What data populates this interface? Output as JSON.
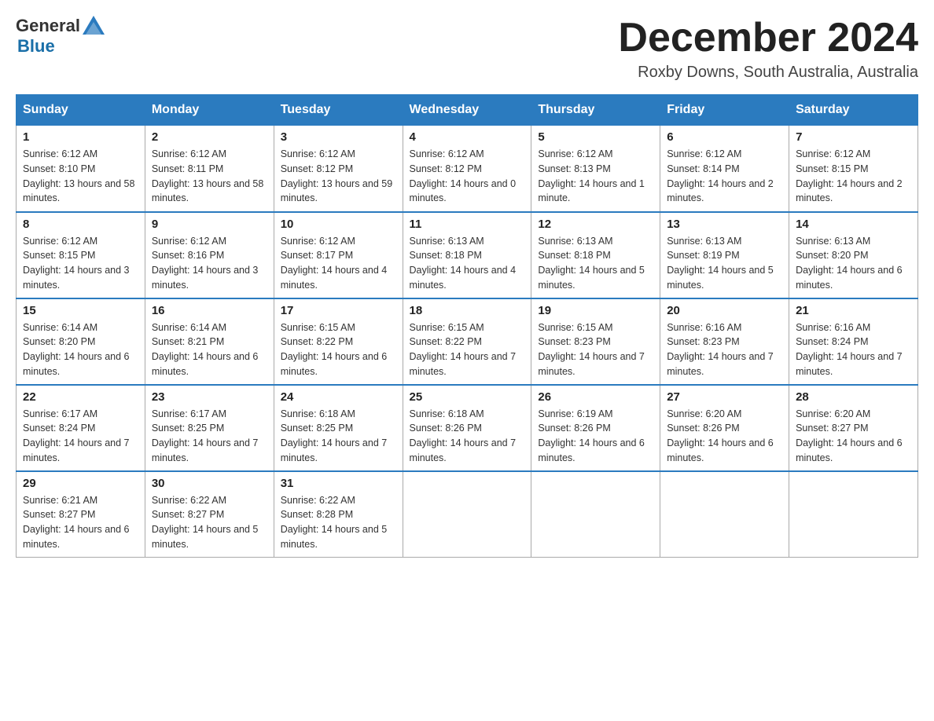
{
  "header": {
    "logo_general": "General",
    "logo_blue": "Blue",
    "month_title": "December 2024",
    "location": "Roxby Downs, South Australia, Australia"
  },
  "days_of_week": [
    "Sunday",
    "Monday",
    "Tuesday",
    "Wednesday",
    "Thursday",
    "Friday",
    "Saturday"
  ],
  "weeks": [
    [
      {
        "day": "1",
        "sunrise": "6:12 AM",
        "sunset": "8:10 PM",
        "daylight": "13 hours and 58 minutes."
      },
      {
        "day": "2",
        "sunrise": "6:12 AM",
        "sunset": "8:11 PM",
        "daylight": "13 hours and 58 minutes."
      },
      {
        "day": "3",
        "sunrise": "6:12 AM",
        "sunset": "8:12 PM",
        "daylight": "13 hours and 59 minutes."
      },
      {
        "day": "4",
        "sunrise": "6:12 AM",
        "sunset": "8:12 PM",
        "daylight": "14 hours and 0 minutes."
      },
      {
        "day": "5",
        "sunrise": "6:12 AM",
        "sunset": "8:13 PM",
        "daylight": "14 hours and 1 minute."
      },
      {
        "day": "6",
        "sunrise": "6:12 AM",
        "sunset": "8:14 PM",
        "daylight": "14 hours and 2 minutes."
      },
      {
        "day": "7",
        "sunrise": "6:12 AM",
        "sunset": "8:15 PM",
        "daylight": "14 hours and 2 minutes."
      }
    ],
    [
      {
        "day": "8",
        "sunrise": "6:12 AM",
        "sunset": "8:15 PM",
        "daylight": "14 hours and 3 minutes."
      },
      {
        "day": "9",
        "sunrise": "6:12 AM",
        "sunset": "8:16 PM",
        "daylight": "14 hours and 3 minutes."
      },
      {
        "day": "10",
        "sunrise": "6:12 AM",
        "sunset": "8:17 PM",
        "daylight": "14 hours and 4 minutes."
      },
      {
        "day": "11",
        "sunrise": "6:13 AM",
        "sunset": "8:18 PM",
        "daylight": "14 hours and 4 minutes."
      },
      {
        "day": "12",
        "sunrise": "6:13 AM",
        "sunset": "8:18 PM",
        "daylight": "14 hours and 5 minutes."
      },
      {
        "day": "13",
        "sunrise": "6:13 AM",
        "sunset": "8:19 PM",
        "daylight": "14 hours and 5 minutes."
      },
      {
        "day": "14",
        "sunrise": "6:13 AM",
        "sunset": "8:20 PM",
        "daylight": "14 hours and 6 minutes."
      }
    ],
    [
      {
        "day": "15",
        "sunrise": "6:14 AM",
        "sunset": "8:20 PM",
        "daylight": "14 hours and 6 minutes."
      },
      {
        "day": "16",
        "sunrise": "6:14 AM",
        "sunset": "8:21 PM",
        "daylight": "14 hours and 6 minutes."
      },
      {
        "day": "17",
        "sunrise": "6:15 AM",
        "sunset": "8:22 PM",
        "daylight": "14 hours and 6 minutes."
      },
      {
        "day": "18",
        "sunrise": "6:15 AM",
        "sunset": "8:22 PM",
        "daylight": "14 hours and 7 minutes."
      },
      {
        "day": "19",
        "sunrise": "6:15 AM",
        "sunset": "8:23 PM",
        "daylight": "14 hours and 7 minutes."
      },
      {
        "day": "20",
        "sunrise": "6:16 AM",
        "sunset": "8:23 PM",
        "daylight": "14 hours and 7 minutes."
      },
      {
        "day": "21",
        "sunrise": "6:16 AM",
        "sunset": "8:24 PM",
        "daylight": "14 hours and 7 minutes."
      }
    ],
    [
      {
        "day": "22",
        "sunrise": "6:17 AM",
        "sunset": "8:24 PM",
        "daylight": "14 hours and 7 minutes."
      },
      {
        "day": "23",
        "sunrise": "6:17 AM",
        "sunset": "8:25 PM",
        "daylight": "14 hours and 7 minutes."
      },
      {
        "day": "24",
        "sunrise": "6:18 AM",
        "sunset": "8:25 PM",
        "daylight": "14 hours and 7 minutes."
      },
      {
        "day": "25",
        "sunrise": "6:18 AM",
        "sunset": "8:26 PM",
        "daylight": "14 hours and 7 minutes."
      },
      {
        "day": "26",
        "sunrise": "6:19 AM",
        "sunset": "8:26 PM",
        "daylight": "14 hours and 6 minutes."
      },
      {
        "day": "27",
        "sunrise": "6:20 AM",
        "sunset": "8:26 PM",
        "daylight": "14 hours and 6 minutes."
      },
      {
        "day": "28",
        "sunrise": "6:20 AM",
        "sunset": "8:27 PM",
        "daylight": "14 hours and 6 minutes."
      }
    ],
    [
      {
        "day": "29",
        "sunrise": "6:21 AM",
        "sunset": "8:27 PM",
        "daylight": "14 hours and 6 minutes."
      },
      {
        "day": "30",
        "sunrise": "6:22 AM",
        "sunset": "8:27 PM",
        "daylight": "14 hours and 5 minutes."
      },
      {
        "day": "31",
        "sunrise": "6:22 AM",
        "sunset": "8:28 PM",
        "daylight": "14 hours and 5 minutes."
      },
      null,
      null,
      null,
      null
    ]
  ]
}
